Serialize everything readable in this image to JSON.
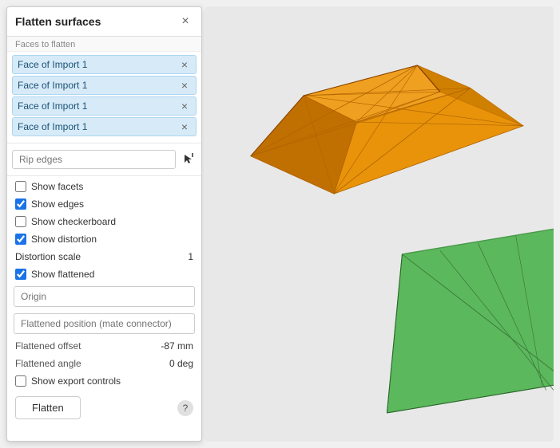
{
  "panel": {
    "title": "Flatten surfaces",
    "close_label": "×",
    "section_faces": "Faces to flatten",
    "faces": [
      {
        "label": "Face of Import 1"
      },
      {
        "label": "Face of Import 1"
      },
      {
        "label": "Face of Import 1"
      },
      {
        "label": "Face of Import 1"
      }
    ],
    "rip_edges_placeholder": "Rip edges",
    "show_facets_label": "Show facets",
    "show_edges_label": "Show edges",
    "show_checkerboard_label": "Show checkerboard",
    "show_distortion_label": "Show distortion",
    "distortion_scale_label": "Distortion scale",
    "distortion_scale_value": "1",
    "show_flattened_label": "Show flattened",
    "origin_placeholder": "Origin",
    "flattened_position_placeholder": "Flattened position (mate connector)",
    "flattened_offset_label": "Flattened offset",
    "flattened_offset_value": "-87 mm",
    "flattened_angle_label": "Flattened angle",
    "flattened_angle_value": "0 deg",
    "show_export_label": "Show export controls",
    "flatten_button": "Flatten",
    "help_icon": "?",
    "checkboxes": {
      "show_facets": false,
      "show_edges": true,
      "show_checkerboard": false,
      "show_distortion": true,
      "show_flattened": true,
      "show_export": false
    }
  }
}
